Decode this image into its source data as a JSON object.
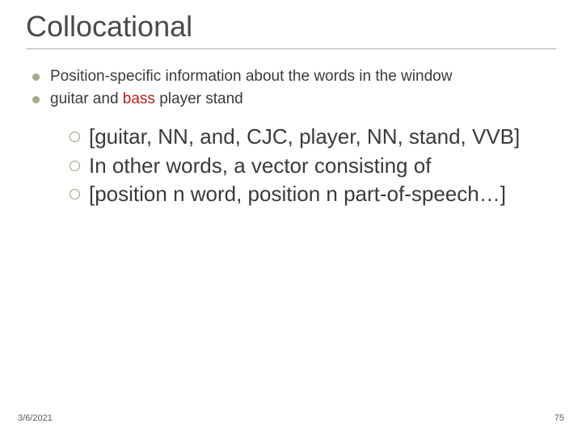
{
  "title": "Collocational",
  "bullets": {
    "item0": "Position-specific information about the words in the window",
    "item1_pre": "guitar and ",
    "item1_hl": "bass",
    "item1_post": " player stand"
  },
  "sub": {
    "s0": "[guitar, NN, and, CJC, player, NN, stand, VVB]",
    "s1": "In other words, a vector consisting of",
    "s2": "[position n word, position n part-of-speech…]"
  },
  "footer": {
    "date": "3/6/2021",
    "page": "75"
  }
}
